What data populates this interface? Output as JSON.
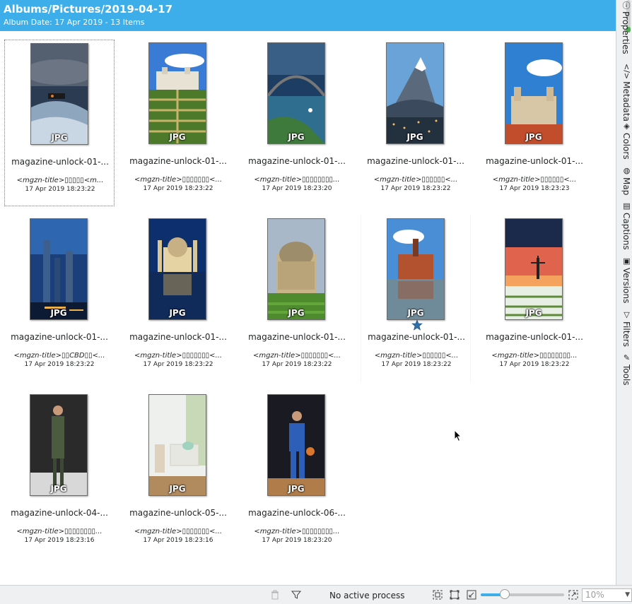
{
  "header": {
    "title": "Albums/Pictures/2019-04-17",
    "subtitle": "Album Date: 17 Apr 2019 - 13 Items"
  },
  "items": [
    {
      "name": "magazine-unlock-01-...",
      "title": "<mgzn-title>▯▯▯▯▯<m...",
      "date": "17 Apr 2019 18:23:22",
      "badge": "JPG",
      "scene": "storm"
    },
    {
      "name": "magazine-unlock-01-...",
      "title": "<mgzn-title>▯▯▯▯▯▯▯<...",
      "date": "17 Apr 2019 18:23:22",
      "badge": "JPG",
      "scene": "garden"
    },
    {
      "name": "magazine-unlock-01-...",
      "title": "<mgzn-title>▯▯▯▯▯▯▯▯...",
      "date": "17 Apr 2019 18:23:20",
      "badge": "JPG",
      "scene": "harbour"
    },
    {
      "name": "magazine-unlock-01-...",
      "title": "<mgzn-title>▯▯▯▯▯▯<...",
      "date": "17 Apr 2019 18:23:22",
      "badge": "JPG",
      "scene": "mountain"
    },
    {
      "name": "magazine-unlock-01-...",
      "title": "<mgzn-title>▯▯▯▯▯▯<...",
      "date": "17 Apr 2019 18:23:23",
      "badge": "JPG",
      "scene": "palace"
    },
    {
      "name": "magazine-unlock-01-...",
      "title": "<mgzn-title>▯▯CBD▯▯<...",
      "date": "17 Apr 2019 18:23:22",
      "badge": "JPG",
      "scene": "city"
    },
    {
      "name": "magazine-unlock-01-...",
      "title": "<mgzn-title>▯▯▯▯▯▯▯<...",
      "date": "17 Apr 2019 18:23:22",
      "badge": "JPG",
      "scene": "church"
    },
    {
      "name": "magazine-unlock-01-...",
      "title": "<mgzn-title>▯▯▯▯▯▯▯<...",
      "date": "17 Apr 2019 18:23:22",
      "badge": "JPG",
      "scene": "dome"
    },
    {
      "name": "magazine-unlock-01-...",
      "title": "<mgzn-title>▯▯▯▯▯▯<...",
      "date": "17 Apr 2019 18:23:22",
      "badge": "JPG",
      "scene": "cathedral",
      "starred": true
    },
    {
      "name": "magazine-unlock-01-...",
      "title": "<mgzn-title>▯▯▯▯▯▯▯▯...",
      "date": "17 Apr 2019 18:23:22",
      "badge": "JPG",
      "scene": "tulips"
    },
    {
      "name": "magazine-unlock-04-...",
      "title": "<mgzn-title>▯▯▯▯▯▯▯▯...",
      "date": "17 Apr 2019 18:23:16",
      "badge": "JPG",
      "scene": "fashion"
    },
    {
      "name": "magazine-unlock-05-...",
      "title": "<mgzn-title>▯▯▯▯▯▯▯<...",
      "date": "17 Apr 2019 18:23:16",
      "badge": "JPG",
      "scene": "room"
    },
    {
      "name": "magazine-unlock-06-...",
      "title": "<mgzn-title>▯▯▯▯▯▯▯▯...",
      "date": "17 Apr 2019 18:23:20",
      "badge": "JPG",
      "scene": "basketball"
    }
  ],
  "sidebar_tabs": [
    {
      "label": "Properties",
      "icon": "info-icon"
    },
    {
      "label": "Metadata",
      "icon": "code-icon"
    },
    {
      "label": "Colors",
      "icon": "paint-bucket-icon"
    },
    {
      "label": "Map",
      "icon": "globe-icon"
    },
    {
      "label": "Captions",
      "icon": "caption-icon"
    },
    {
      "label": "Versions",
      "icon": "versions-icon"
    },
    {
      "label": "Filters",
      "icon": "filter-icon"
    },
    {
      "label": "Tools",
      "icon": "tools-icon"
    }
  ],
  "status": {
    "process": "No active process",
    "zoom": "10%",
    "zoom_level": 0.29
  },
  "colors": {
    "accent": "#3daee9",
    "panel": "#eff0f1",
    "star": "#2f6fa8"
  }
}
